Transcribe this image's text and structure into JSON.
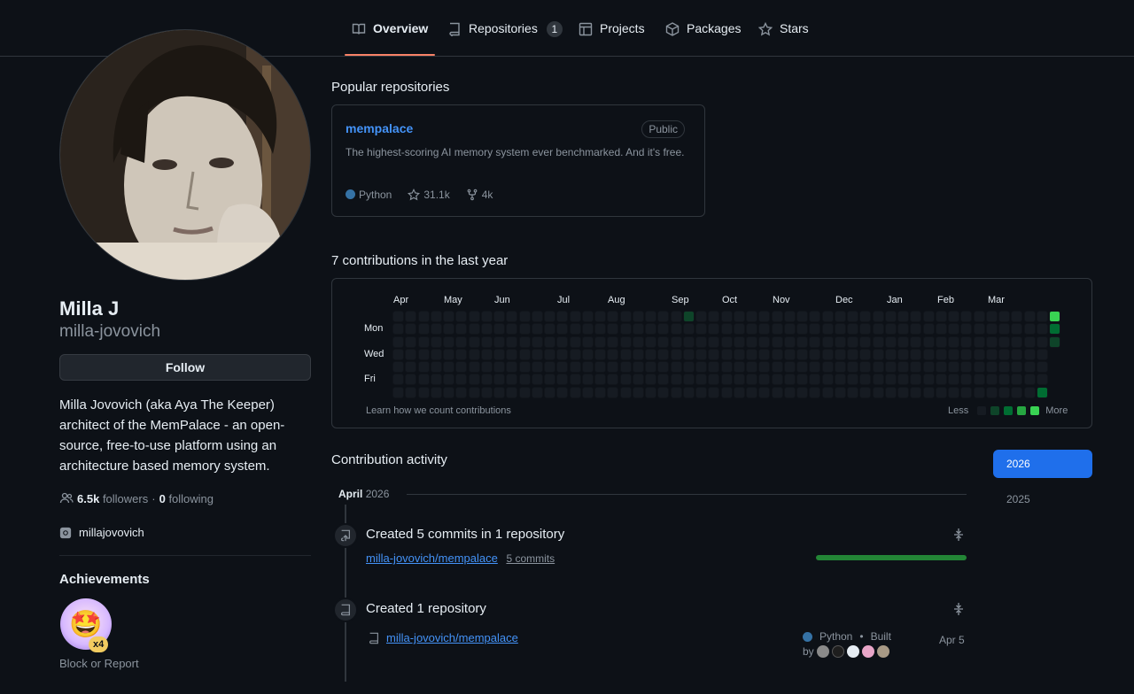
{
  "nav": {
    "tabs": [
      {
        "label": "Overview",
        "icon": "book-icon",
        "active": true
      },
      {
        "label": "Repositories",
        "icon": "repo-icon",
        "count": "1"
      },
      {
        "label": "Projects",
        "icon": "table-icon"
      },
      {
        "label": "Packages",
        "icon": "package-icon"
      },
      {
        "label": "Stars",
        "icon": "star-icon"
      }
    ]
  },
  "profile": {
    "name": "Milla J",
    "login": "milla-jovovich",
    "follow_label": "Follow",
    "bio": "Milla Jovovich (aka Aya The Keeper) architect of the MemPalace - an open-source, free-to-use platform using an architecture based memory system.",
    "followers_count": "6.5k",
    "followers_label": "followers",
    "sep": "·",
    "following_count": "0",
    "following_label": "following",
    "social": "millajovovich",
    "achievements_title": "Achievements",
    "achievement_multiplier": "x4",
    "block_label": "Block or Report"
  },
  "popular": {
    "title": "Popular repositories",
    "repo": {
      "name": "mempalace",
      "visibility": "Public",
      "description": "The highest-scoring AI memory system ever benchmarked. And it's free.",
      "language": "Python",
      "language_color": "#3572A5",
      "stars": "31.1k",
      "forks": "4k"
    }
  },
  "contributions": {
    "title": "7 contributions in the last year",
    "months": [
      "Apr",
      "May",
      "Jun",
      "Jul",
      "Aug",
      "Sep",
      "Oct",
      "Nov",
      "Dec",
      "Jan",
      "Feb",
      "Mar"
    ],
    "days": [
      "Mon",
      "Wed",
      "Fri"
    ],
    "learn_link": "Learn how we count contributions",
    "less": "Less",
    "more": "More",
    "level_colors": [
      "#161b22",
      "#0e4429",
      "#006d32",
      "#26a641",
      "#39d353"
    ]
  },
  "activity": {
    "title": "Contribution activity",
    "years": [
      "2026",
      "2025"
    ],
    "month_name": "April",
    "month_year": "2026",
    "items": [
      {
        "title": "Created 5 commits in 1 repository",
        "repo": "milla-jovovich/mempalace",
        "commits": "5 commits"
      },
      {
        "title": "Created 1 repository",
        "repo": "milla-jovovich/mempalace",
        "language": "Python",
        "built_label": "Built",
        "by_label": "by",
        "date": "Apr 5"
      }
    ]
  }
}
